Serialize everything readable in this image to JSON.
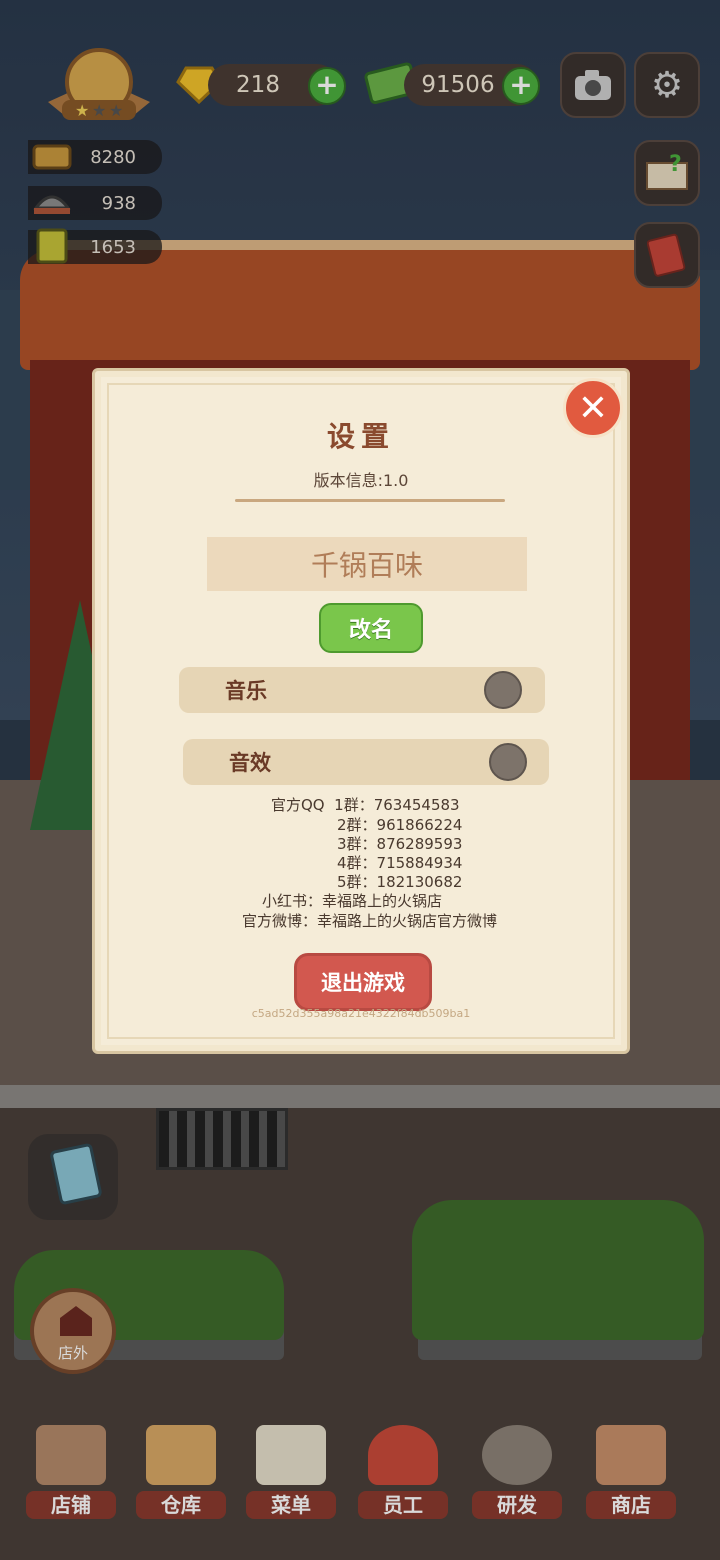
{
  "hud": {
    "gems": "218",
    "cash": "91506",
    "stat_1": "8280",
    "stat_2": "938",
    "stat_3": "1653"
  },
  "settings": {
    "title": "设置",
    "version": "版本信息:1.0",
    "player_name": "千锅百味",
    "rename_label": "改名",
    "music_label": "音乐",
    "sound_label": "音效",
    "info_lines": [
      "官方QQ  1群：763454583",
      "2群：961866224",
      "3群：876289593",
      "4群：715884934",
      "5群：182130682",
      "小红书：幸福路上的火锅店",
      "官方微博：幸福路上的火锅店官方微博"
    ],
    "exit_label": "退出游戏",
    "device_id": "c5ad52d355a98a21e4322f84db509ba1"
  },
  "side": {
    "outside_label": "店外"
  },
  "nav": [
    {
      "label": "店铺"
    },
    {
      "label": "仓库"
    },
    {
      "label": "菜单"
    },
    {
      "label": "员工"
    },
    {
      "label": "研发"
    },
    {
      "label": "商店"
    }
  ],
  "colors": {
    "accent": "#d2584f",
    "rename": "#7ac64b",
    "panel": "#f5ecd8"
  }
}
